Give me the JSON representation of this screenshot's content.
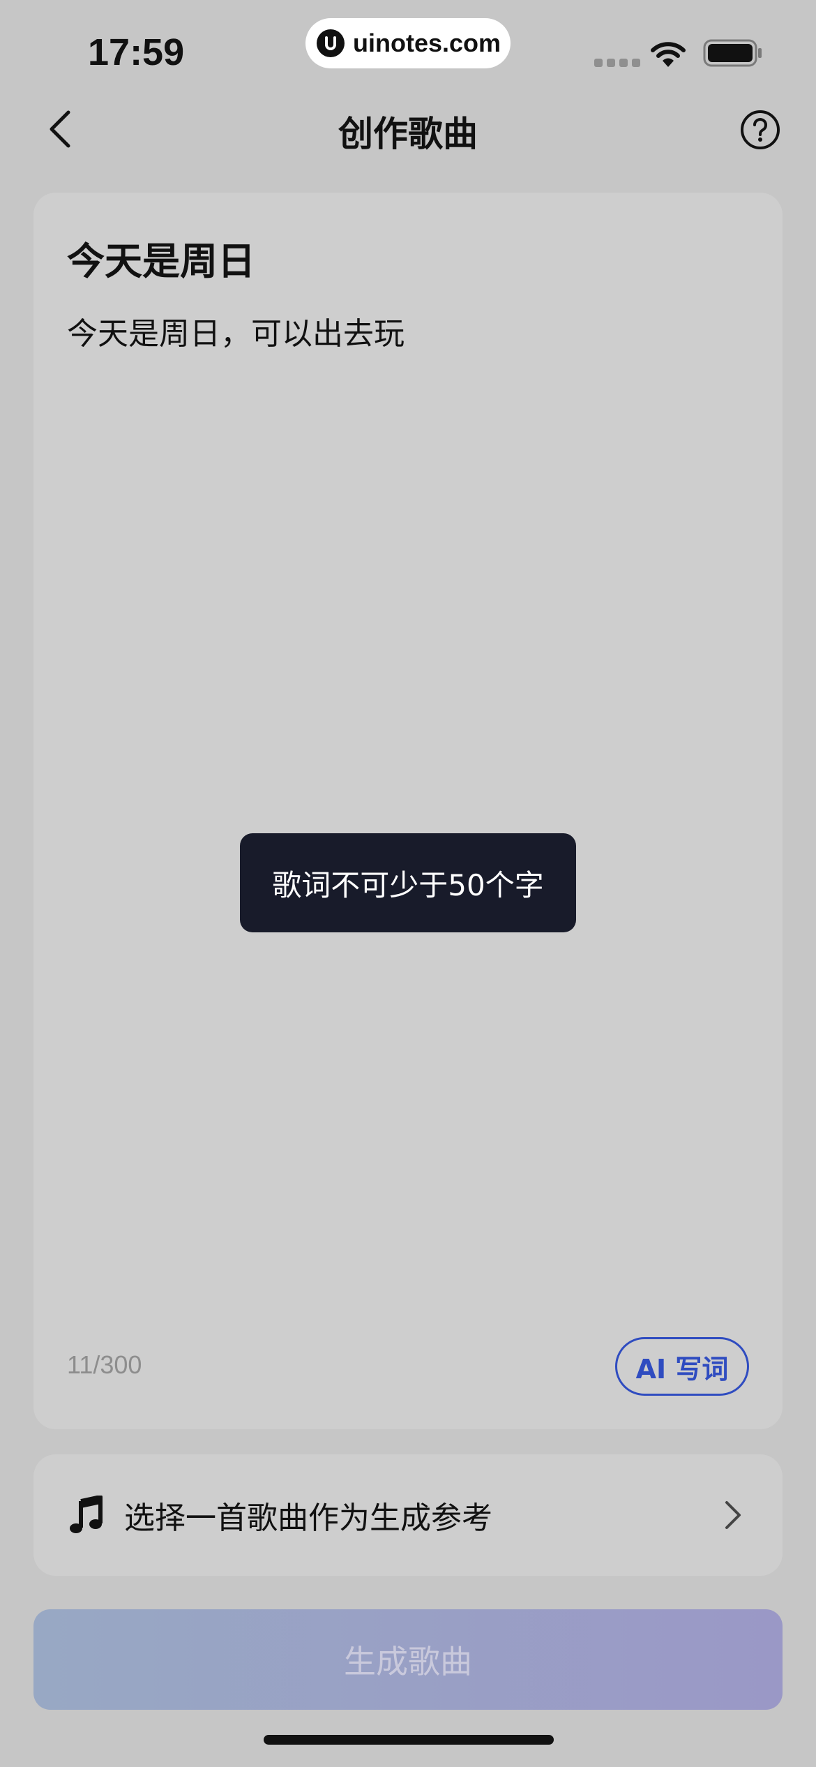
{
  "status_bar": {
    "time": "17:59",
    "url": "uinotes.com"
  },
  "nav": {
    "title": "创作歌曲"
  },
  "lyrics": {
    "title": "今天是周日",
    "body": "今天是周日，可以出去玩",
    "char_count": "11/300",
    "ai_button_label": "AI 写词"
  },
  "toast": {
    "message": "歌词不可少于50个字"
  },
  "reference": {
    "label": "选择一首歌曲作为生成参考"
  },
  "generate": {
    "label": "生成歌曲"
  },
  "colors": {
    "accent": "#2f4cc0",
    "toast_bg": "#181b2a",
    "button_gradient_start": "#98a8c4",
    "button_gradient_end": "#9a98c6"
  },
  "icons": {
    "back": "chevron-left-icon",
    "help": "question-circle-icon",
    "music": "music-note-icon",
    "forward": "chevron-right-icon",
    "wifi": "wifi-icon",
    "battery": "battery-icon"
  }
}
